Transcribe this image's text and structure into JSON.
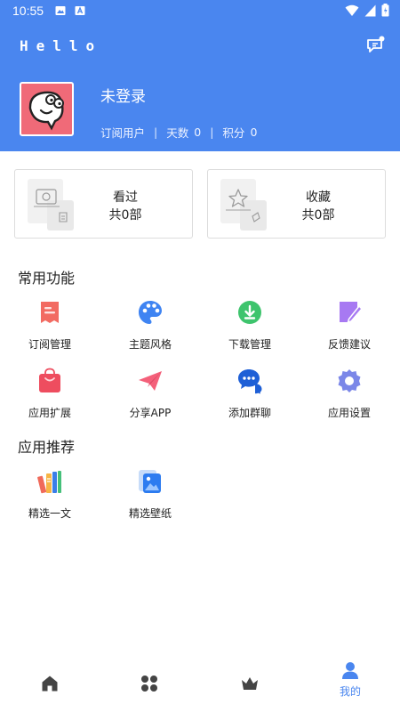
{
  "status_bar": {
    "time": "10:55"
  },
  "header": {
    "title": "Hello"
  },
  "profile": {
    "name": "未登录",
    "role": "订阅用户",
    "days_label": "天数",
    "days_value": "0",
    "points_label": "积分",
    "points_value": "0"
  },
  "cards": [
    {
      "title": "看过",
      "count": "共0部"
    },
    {
      "title": "收藏",
      "count": "共0部"
    }
  ],
  "common_functions": {
    "title": "常用功能",
    "items": [
      {
        "label": "订阅管理",
        "icon": "subscription-icon"
      },
      {
        "label": "主题风格",
        "icon": "palette-icon"
      },
      {
        "label": "下载管理",
        "icon": "download-icon"
      },
      {
        "label": "反馈建议",
        "icon": "edit-icon"
      },
      {
        "label": "应用扩展",
        "icon": "shopping-bag-icon"
      },
      {
        "label": "分享APP",
        "icon": "paper-plane-icon"
      },
      {
        "label": "添加群聊",
        "icon": "chat-bubbles-icon"
      },
      {
        "label": "应用设置",
        "icon": "gear-icon"
      }
    ]
  },
  "recommendations": {
    "title": "应用推荐",
    "items": [
      {
        "label": "精选一文",
        "icon": "books-icon"
      },
      {
        "label": "精选壁纸",
        "icon": "wallpaper-icon"
      }
    ]
  },
  "bottom_nav": {
    "items": [
      {
        "icon": "home-icon",
        "label": ""
      },
      {
        "icon": "apps-grid-icon",
        "label": ""
      },
      {
        "icon": "crown-icon",
        "label": ""
      },
      {
        "icon": "user-icon",
        "label": "我的",
        "active": true
      }
    ]
  },
  "colors": {
    "primary": "#4a86ef",
    "avatar_bg": "#f06a78"
  }
}
